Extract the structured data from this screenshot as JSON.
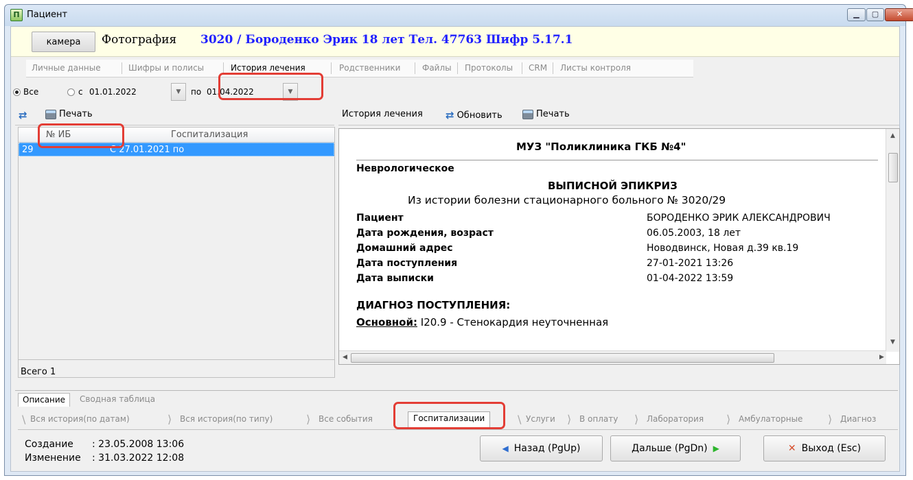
{
  "window": {
    "title": "Пациент"
  },
  "header": {
    "camera_button": "камера",
    "photo_label": "Фотография",
    "patient_info": "3020 / Бороденко Эрик 18 лет Тел. 47763 Шифр 5.17.1"
  },
  "top_tabs": [
    "Личные данные",
    "Шифры и полисы",
    "История лечения",
    "Родственники",
    "Файлы",
    "Протоколы",
    "CRM",
    "Листы контроля"
  ],
  "filter": {
    "all_label": "Все",
    "from_label": "с",
    "from_date": "01.01.2022",
    "to_label": "по",
    "to_date": "01.04.2022"
  },
  "left_toolbar": {
    "print_label": "Печать"
  },
  "grid": {
    "columns": [
      "№ ИБ",
      "Госпитализация"
    ],
    "rows": [
      {
        "ib": "29",
        "hosp": "С 27.01.2021 по"
      }
    ],
    "total": "Всего 1"
  },
  "right_toolbar": {
    "history_label": "История лечения",
    "refresh_label": "Обновить",
    "print_label": "Печать"
  },
  "document": {
    "title": "МУЗ \"Поликлиника ГКБ №4\"",
    "department": "Неврологическое",
    "epicrisis": "ВЫПИСНОЙ ЭПИКРИЗ",
    "from_history": "Из истории болезни стационарного больного № 3020/29",
    "fields": [
      {
        "label": "Пациент",
        "value": "БОРОДЕНКО ЭРИК АЛЕКСАНДРОВИЧ"
      },
      {
        "label": "Дата рождения, возраст",
        "value": "06.05.2003, 18 лет"
      },
      {
        "label": "Домашний адрес",
        "value": "Новодвинск, Новая д.39 кв.19"
      },
      {
        "label": "Дата поступления",
        "value": "27-01-2021 13:26"
      },
      {
        "label": "Дата выписки",
        "value": "01-04-2022 13:59"
      }
    ],
    "diagnosis_heading": "ДИАГНОЗ ПОСТУПЛЕНИЯ:",
    "main_label": "Основной:",
    "main_value": "I20.9 - Стенокардия неуточненная"
  },
  "description_tabs": [
    "Описание",
    "Сводная таблица"
  ],
  "bottom_tabs": [
    "Вся история(по датам)",
    "Вся история(по типу)",
    "Все события",
    "Госпитализации",
    "Услуги",
    "В оплату",
    "Лаборатория",
    "Амбулаторные",
    "Диагноз"
  ],
  "meta": {
    "created_label": "Создание",
    "created_value": ": 23.05.2008 13:06",
    "changed_label": "Изменение",
    "changed_value": ": 31.03.2022 12:08"
  },
  "buttons": {
    "back": "Назад (PgUp)",
    "next": "Дальше (PgDn)",
    "exit": "Выход (Esc)"
  },
  "colors": {
    "selection": "#3399ff",
    "highlight": "#e33d35",
    "accent_text": "#2020ff"
  }
}
